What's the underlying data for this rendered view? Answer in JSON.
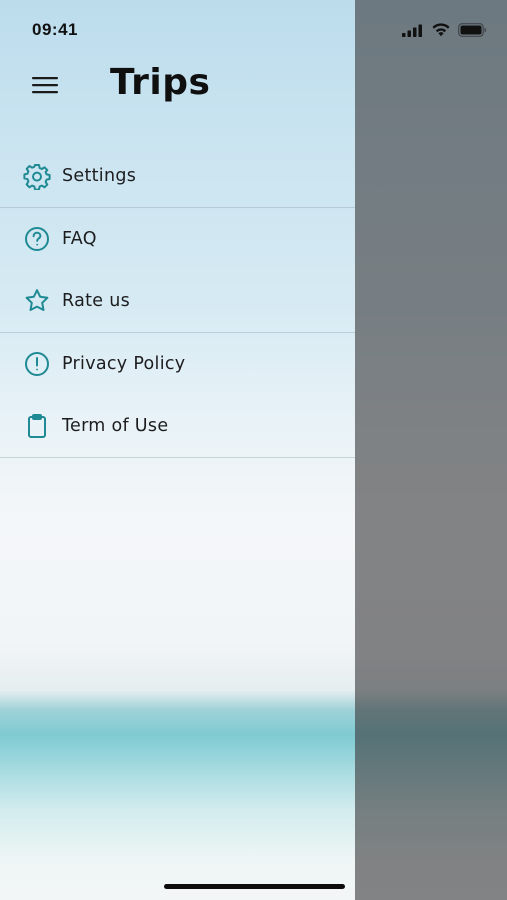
{
  "status_bar": {
    "time": "09:41",
    "icons": [
      "signal-icon",
      "wifi-icon",
      "battery-icon"
    ]
  },
  "header": {
    "menu_icon": "hamburger-menu-icon",
    "title": "Trips"
  },
  "menu": {
    "items": [
      {
        "label": "Settings",
        "icon": "gear-icon"
      },
      {
        "label": "FAQ",
        "icon": "question-circle-icon"
      },
      {
        "label": "Rate us",
        "icon": "star-icon"
      },
      {
        "label": "Privacy Policy",
        "icon": "exclamation-circle-icon"
      },
      {
        "label": "Term of Use",
        "icon": "clipboard-icon"
      }
    ]
  },
  "colors": {
    "icon_accent": "#1f8a93",
    "text": "#1d1d1f",
    "scrim": "#5a5c5e"
  }
}
